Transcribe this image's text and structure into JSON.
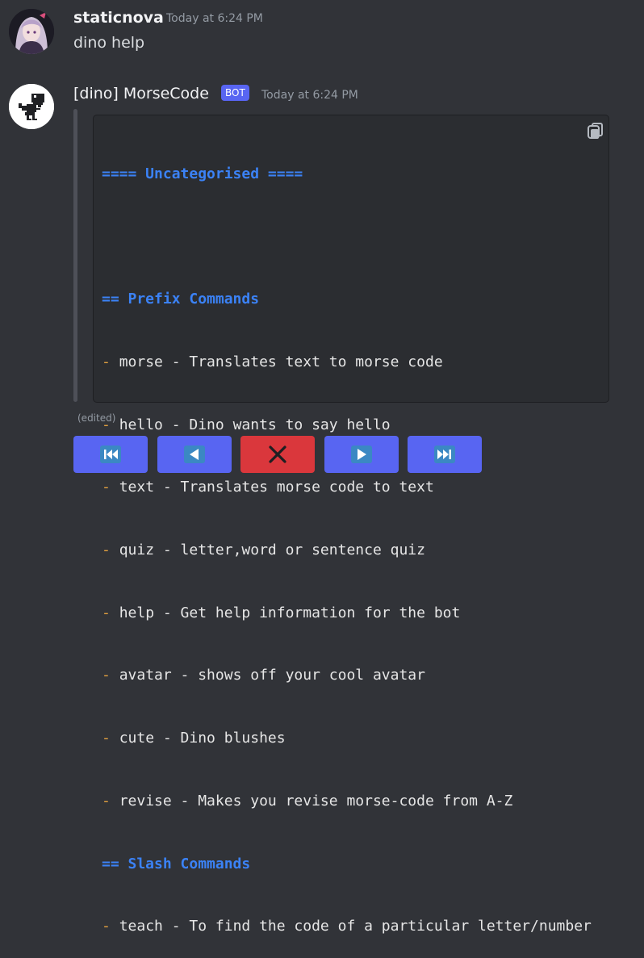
{
  "messages": [
    {
      "author": "staticnova",
      "timestamp": "Today at 6:24 PM",
      "text": "dino help"
    },
    {
      "author": "[dino] MorseCode",
      "badge": "BOT",
      "timestamp": "Today at 6:24 PM",
      "edited": "(edited)"
    }
  ],
  "code": {
    "header": "==== Uncategorised ====",
    "prefix_header": "== Prefix Commands",
    "slash_header": "== Slash Commands",
    "prefix_commands": [
      "morse - Translates text to morse code",
      "hello - Dino wants to say hello",
      "text - Translates morse code to text",
      "quiz - letter,word or sentence quiz",
      "help - Get help information for the bot",
      "avatar - shows off your cool avatar",
      "cute - Dino blushes",
      "revise - Makes you revise morse-code from A-Z"
    ],
    "slash_commands": [
      "teach - To find the code of a particular letter/number"
    ],
    "bullet": "-"
  },
  "buttons": [
    {
      "name": "first-page-button",
      "icon": "skip-back-icon",
      "style": "blurple"
    },
    {
      "name": "previous-page-button",
      "icon": "play-left-icon",
      "style": "blurple"
    },
    {
      "name": "close-button",
      "icon": "close-icon",
      "style": "red"
    },
    {
      "name": "next-page-button",
      "icon": "play-right-icon",
      "style": "blurple"
    },
    {
      "name": "last-page-button",
      "icon": "skip-forward-icon",
      "style": "blurple"
    }
  ],
  "colors": {
    "background": "#313338",
    "codeblock": "#2b2d31",
    "blurple": "#5865f2",
    "danger": "#da373c",
    "category": "#3b82f6",
    "bullet": "#e0a040"
  }
}
